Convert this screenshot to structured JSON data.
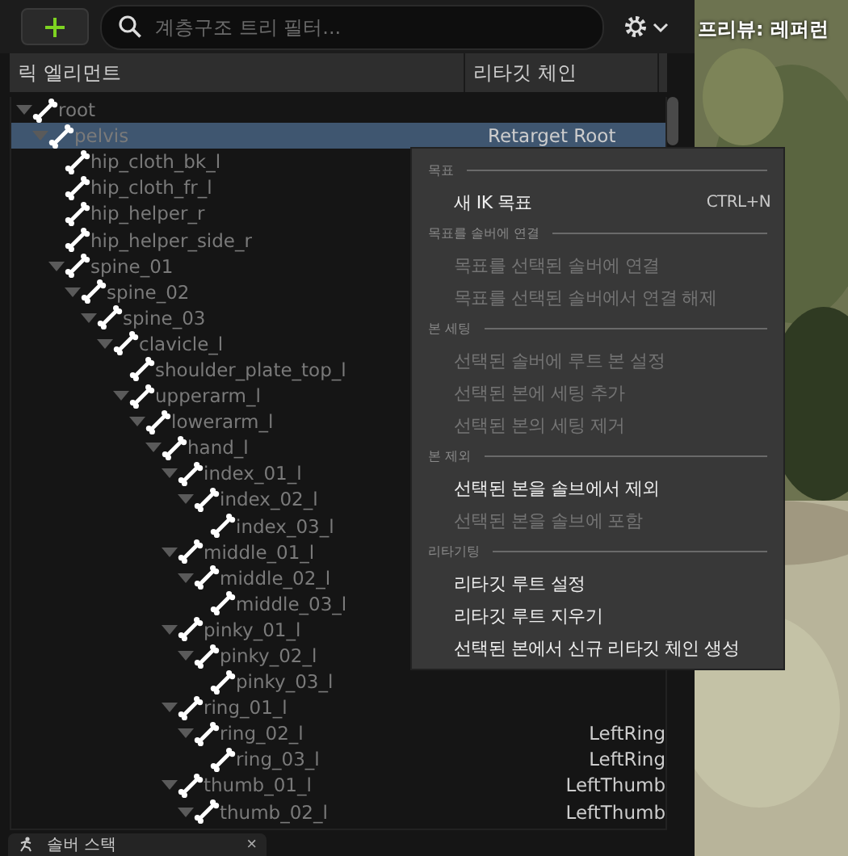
{
  "toolbar": {
    "search": {
      "placeholder": "계층구조 트리 필터..."
    }
  },
  "columns": [
    "릭 엘리먼트",
    "리타깃 체인"
  ],
  "tree": [
    {
      "name": "root",
      "expanded": true,
      "selected": false,
      "children": [
        {
          "name": "pelvis",
          "expanded": true,
          "selected": true,
          "chain": "Retarget Root",
          "children": [
            {
              "name": "hip_cloth_bk_l",
              "selected": false
            },
            {
              "name": "hip_cloth_fr_l",
              "selected": false
            },
            {
              "name": "hip_helper_r",
              "selected": false
            },
            {
              "name": "hip_helper_side_r",
              "selected": false
            },
            {
              "name": "spine_01",
              "expanded": true,
              "selected": false,
              "children": [
                {
                  "name": "spine_02",
                  "expanded": true,
                  "selected": false,
                  "children": [
                    {
                      "name": "spine_03",
                      "expanded": true,
                      "selected": false,
                      "children": [
                        {
                          "name": "clavicle_l",
                          "expanded": true,
                          "selected": false,
                          "children": [
                            {
                              "name": "shoulder_plate_top_l",
                              "selected": false
                            },
                            {
                              "name": "upperarm_l",
                              "expanded": true,
                              "selected": false,
                              "children": [
                                {
                                  "name": "lowerarm_l",
                                  "expanded": true,
                                  "selected": false,
                                  "children": [
                                    {
                                      "name": "hand_l",
                                      "expanded": true,
                                      "selected": false,
                                      "children": [
                                        {
                                          "name": "index_01_l",
                                          "expanded": true,
                                          "selected": false,
                                          "children": [
                                            {
                                              "name": "index_02_l",
                                              "expanded": true,
                                              "selected": false,
                                              "children": [
                                                {
                                                  "name": "index_03_l",
                                                  "selected": false
                                                }
                                              ]
                                            }
                                          ]
                                        },
                                        {
                                          "name": "middle_01_l",
                                          "expanded": true,
                                          "selected": false,
                                          "children": [
                                            {
                                              "name": "middle_02_l",
                                              "expanded": true,
                                              "selected": false,
                                              "children": [
                                                {
                                                  "name": "middle_03_l",
                                                  "selected": false
                                                }
                                              ]
                                            }
                                          ]
                                        },
                                        {
                                          "name": "pinky_01_l",
                                          "expanded": true,
                                          "selected": false,
                                          "children": [
                                            {
                                              "name": "pinky_02_l",
                                              "expanded": true,
                                              "selected": false,
                                              "children": [
                                                {
                                                  "name": "pinky_03_l",
                                                  "selected": false
                                                }
                                              ]
                                            }
                                          ]
                                        },
                                        {
                                          "name": "ring_01_l",
                                          "expanded": true,
                                          "selected": false,
                                          "children": [
                                            {
                                              "name": "ring_02_l",
                                              "expanded": true,
                                              "selected": false,
                                              "chain": "LeftRing",
                                              "children": [
                                                {
                                                  "name": "ring_03_l",
                                                  "selected": false,
                                                  "chain": "LeftRing"
                                                }
                                              ]
                                            }
                                          ]
                                        },
                                        {
                                          "name": "thumb_01_l",
                                          "expanded": true,
                                          "selected": false,
                                          "chain": "LeftThumb",
                                          "children": [
                                            {
                                              "name": "thumb_02_l",
                                              "expanded": true,
                                              "selected": false,
                                              "chain": "LeftThumb"
                                            }
                                          ]
                                        }
                                      ]
                                    }
                                  ]
                                }
                              ]
                            }
                          ]
                        }
                      ]
                    }
                  ]
                }
              ]
            }
          ]
        }
      ]
    }
  ],
  "context_menu": [
    {
      "heading": "목표",
      "items": [
        {
          "label": "새 IK 목표",
          "shortcut": "CTRL+N",
          "disabled": false
        }
      ]
    },
    {
      "heading": "목표를 솔버에 연결",
      "items": [
        {
          "label": "목표를 선택된 솔버에 연결",
          "disabled": true
        },
        {
          "label": "목표를 선택된 솔버에서 연결 해제",
          "disabled": true
        }
      ]
    },
    {
      "heading": "본 세팅",
      "items": [
        {
          "label": "선택된 솔버에 루트 본 설정",
          "disabled": true
        },
        {
          "label": "선택된 본에 세팅 추가",
          "disabled": true
        },
        {
          "label": "선택된 본의 세팅 제거",
          "disabled": true
        }
      ]
    },
    {
      "heading": "본 제외",
      "items": [
        {
          "label": "선택된 본을 솔브에서 제외",
          "disabled": false
        },
        {
          "label": "선택된 본을 솔브에 포함",
          "disabled": true
        }
      ]
    },
    {
      "heading": "리타기팅",
      "items": [
        {
          "label": "리타깃 루트 설정",
          "disabled": false
        },
        {
          "label": "리타깃 루트 지우기",
          "disabled": false
        },
        {
          "label": "선택된 본에서 신규 리타깃 체인 생성",
          "disabled": false
        }
      ]
    }
  ],
  "bottom_tab": {
    "label": "솔버 스택",
    "close": "×"
  },
  "preview": {
    "title": "프리뷰: 레퍼런"
  }
}
